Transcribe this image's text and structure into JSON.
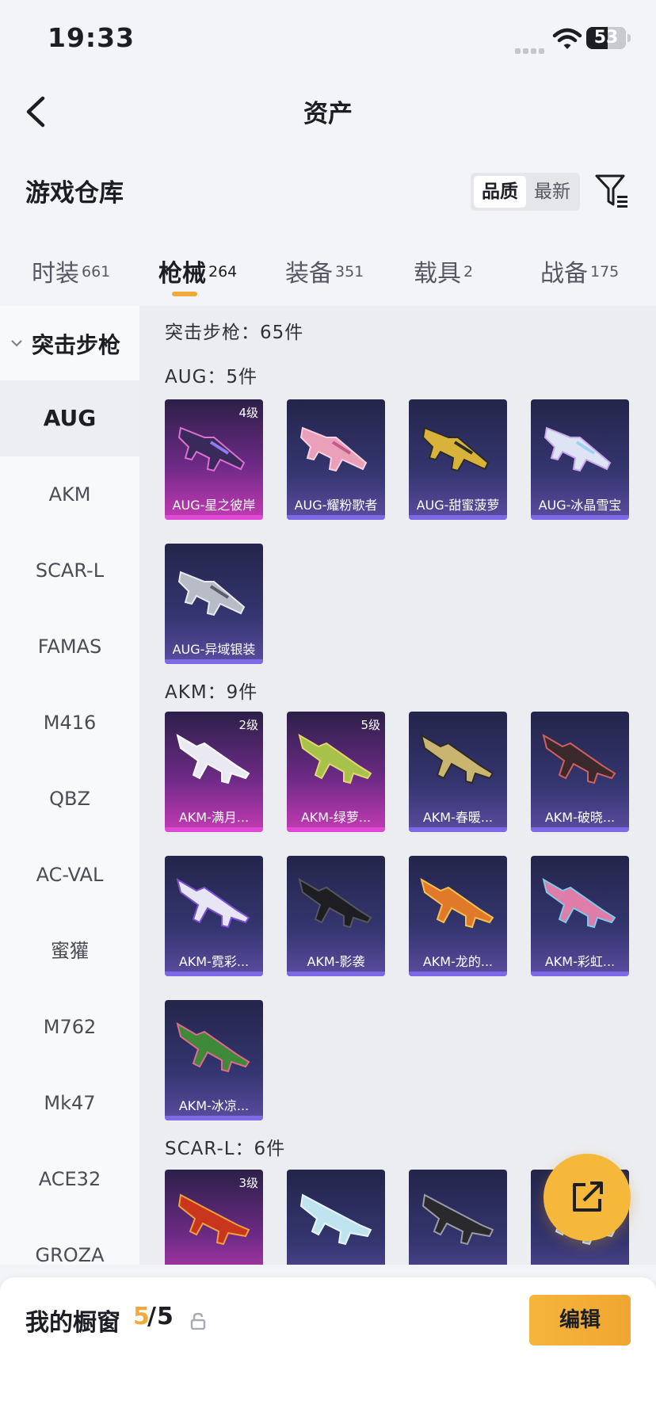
{
  "status_bar": {
    "time": "19:33",
    "battery": "53"
  },
  "nav": {
    "title": "资产"
  },
  "warehouse": {
    "title": "游戏仓库",
    "sort_options": [
      {
        "label": "品质",
        "active": true
      },
      {
        "label": "最新",
        "active": false
      }
    ]
  },
  "tabs": [
    {
      "label": "时装",
      "count": "661"
    },
    {
      "label": "枪械",
      "count": "264",
      "active": true
    },
    {
      "label": "装备",
      "count": "351"
    },
    {
      "label": "载具",
      "count": "2"
    },
    {
      "label": "战备",
      "count": "175"
    }
  ],
  "sidebar": {
    "group": "突击步枪",
    "items": [
      "AUG",
      "AKM",
      "SCAR-L",
      "FAMAS",
      "M416",
      "QBZ",
      "AC-VAL",
      "蜜獾",
      "M762",
      "Mk47",
      "ACE32",
      "GROZA"
    ],
    "active": "AUG"
  },
  "main": {
    "header": "突击步枪：65件",
    "sections": [
      {
        "title": "AUG：5件",
        "items": [
          {
            "name": "AUG-星之彼岸",
            "level": "4级",
            "rarity": "pink"
          },
          {
            "name": "AUG-耀粉歌者",
            "level": "",
            "rarity": "purple"
          },
          {
            "name": "AUG-甜蜜菠萝",
            "level": "",
            "rarity": "purple"
          },
          {
            "name": "AUG-冰晶雪宝",
            "level": "",
            "rarity": "purple"
          },
          {
            "name": "AUG-异域银装",
            "level": "",
            "rarity": "purple"
          }
        ]
      },
      {
        "title": "AKM：9件",
        "items": [
          {
            "name": "AKM-满月...",
            "level": "2级",
            "rarity": "pink"
          },
          {
            "name": "AKM-绿萝...",
            "level": "5级",
            "rarity": "pink"
          },
          {
            "name": "AKM-春暖...",
            "level": "",
            "rarity": "purple"
          },
          {
            "name": "AKM-破晓...",
            "level": "",
            "rarity": "purple"
          },
          {
            "name": "AKM-霓彩...",
            "level": "",
            "rarity": "purple"
          },
          {
            "name": "AKM-影袭",
            "level": "",
            "rarity": "purple"
          },
          {
            "name": "AKM-龙的...",
            "level": "",
            "rarity": "purple"
          },
          {
            "name": "AKM-彩虹...",
            "level": "",
            "rarity": "purple"
          },
          {
            "name": "AKM-冰凉...",
            "level": "",
            "rarity": "purple"
          }
        ]
      },
      {
        "title": "SCAR-L：6件",
        "items": [
          {
            "name": "",
            "level": "3级",
            "rarity": "pink"
          },
          {
            "name": "",
            "level": "",
            "rarity": "purple"
          },
          {
            "name": "",
            "level": "",
            "rarity": "purple"
          },
          {
            "name": "",
            "level": "",
            "rarity": "purple"
          }
        ]
      }
    ]
  },
  "footer": {
    "label": "我的橱窗",
    "used": "5",
    "separator": "/",
    "total": "5",
    "edit": "编辑"
  },
  "colors": {
    "accent": "#f2a93b",
    "rarity_pink": "#e049d6",
    "rarity_purple": "#7d68e6"
  }
}
